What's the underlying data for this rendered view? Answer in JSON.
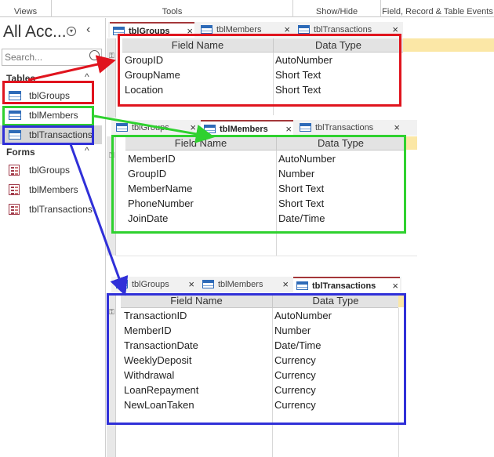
{
  "ribbon": {
    "groups": [
      "Views",
      "Tools",
      "Show/Hide",
      "Field, Record & Table Events"
    ]
  },
  "nav": {
    "title": "All Acc...",
    "search_placeholder": "Search...",
    "tables_header": "Tables",
    "forms_header": "Forms",
    "tables": [
      {
        "label": "tblGroups"
      },
      {
        "label": "tblMembers"
      },
      {
        "label": "tblTransactions"
      }
    ],
    "forms": [
      {
        "label": "tblGroups"
      },
      {
        "label": "tblMembers"
      },
      {
        "label": "tblTransactions"
      }
    ]
  },
  "tabs": {
    "groups": "tblGroups",
    "members": "tblMembers",
    "transactions": "tblTransactions",
    "close": "×"
  },
  "columns": {
    "field_name": "Field Name",
    "data_type": "Data Type"
  },
  "tables": {
    "groups": [
      {
        "field": "GroupID",
        "type": "AutoNumber"
      },
      {
        "field": "GroupName",
        "type": "Short Text"
      },
      {
        "field": "Location",
        "type": "Short Text"
      }
    ],
    "members": [
      {
        "field": "MemberID",
        "type": "AutoNumber"
      },
      {
        "field": "GroupID",
        "type": "Number"
      },
      {
        "field": "MemberName",
        "type": "Short Text"
      },
      {
        "field": "PhoneNumber",
        "type": "Short Text"
      },
      {
        "field": "JoinDate",
        "type": "Date/Time"
      }
    ],
    "transactions": [
      {
        "field": "TransactionID",
        "type": "AutoNumber"
      },
      {
        "field": "MemberID",
        "type": "Number"
      },
      {
        "field": "TransactionDate",
        "type": "Date/Time"
      },
      {
        "field": "WeeklyDeposit",
        "type": "Currency"
      },
      {
        "field": "Withdrawal",
        "type": "Currency"
      },
      {
        "field": "LoanRepayment",
        "type": "Currency"
      },
      {
        "field": "NewLoanTaken",
        "type": "Currency"
      }
    ]
  },
  "colors": {
    "red": "#e0141e",
    "green": "#2fd12f",
    "blue": "#3030d8",
    "tab_accent": "#a4373a"
  }
}
